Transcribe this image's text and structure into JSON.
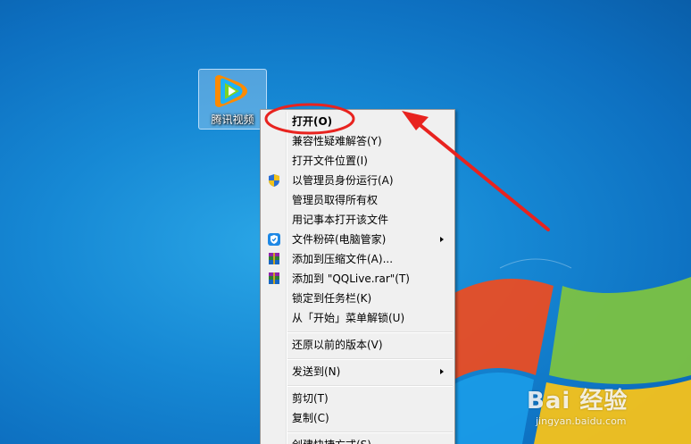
{
  "desktop": {
    "icon_label": "腾讯视频"
  },
  "context_menu": {
    "items": [
      {
        "label": "打开(O)",
        "bold": true,
        "icon": "",
        "submenu": false
      },
      {
        "label": "兼容性疑难解答(Y)",
        "icon": "",
        "submenu": false
      },
      {
        "label": "打开文件位置(I)",
        "icon": "",
        "submenu": false
      },
      {
        "label": "以管理员身份运行(A)",
        "icon": "uac-shield-icon",
        "submenu": false
      },
      {
        "label": "管理员取得所有权",
        "icon": "",
        "submenu": false
      },
      {
        "label": "用记事本打开该文件",
        "icon": "",
        "submenu": false
      },
      {
        "label": "文件粉碎(电脑管家)",
        "icon": "pc-manager-shield-icon",
        "submenu": true
      },
      {
        "label": "添加到压缩文件(A)...",
        "icon": "winrar-icon",
        "submenu": false
      },
      {
        "label": "添加到 \"QQLive.rar\"(T)",
        "icon": "winrar-icon",
        "submenu": false
      },
      {
        "label": "锁定到任务栏(K)",
        "icon": "",
        "submenu": false
      },
      {
        "label": "从「开始」菜单解锁(U)",
        "icon": "",
        "submenu": false
      },
      {
        "label": "还原以前的版本(V)",
        "icon": "",
        "submenu": false
      },
      {
        "label": "发送到(N)",
        "icon": "",
        "submenu": true
      },
      {
        "label": "剪切(T)",
        "icon": "",
        "submenu": false
      },
      {
        "label": "复制(C)",
        "icon": "",
        "submenu": false
      },
      {
        "label": "创建快捷方式(S)",
        "icon": "",
        "submenu": false
      }
    ]
  },
  "watermark": {
    "brand": "Bai 经验",
    "url": "jingyan.baidu.com"
  },
  "colors": {
    "annotation_red": "#e8231f",
    "desktop_blue": "#1688d4"
  }
}
